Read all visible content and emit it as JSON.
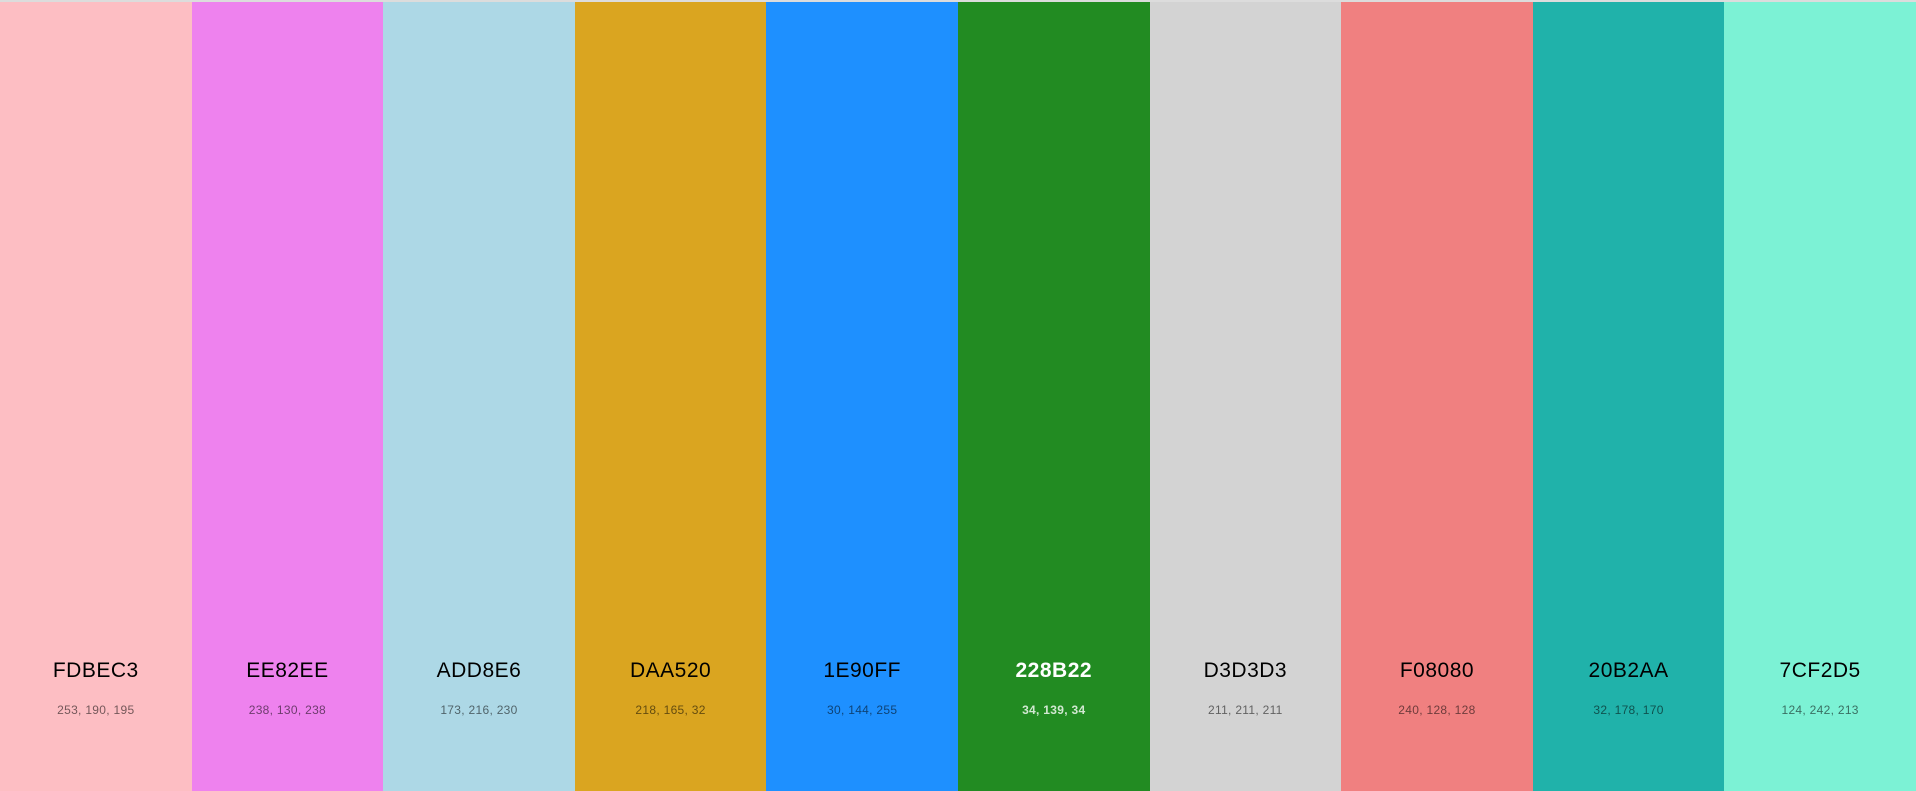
{
  "swatches": [
    {
      "hex": "FDBEC3",
      "rgb": "253, 190, 195",
      "color": "#FDBEC3"
    },
    {
      "hex": "EE82EE",
      "rgb": "238, 130, 238",
      "color": "#EE82EE"
    },
    {
      "hex": "ADD8E6",
      "rgb": "173, 216, 230",
      "color": "#ADD8E6"
    },
    {
      "hex": "DAA520",
      "rgb": "218, 165, 32",
      "color": "#DAA520"
    },
    {
      "hex": "1E90FF",
      "rgb": "30, 144, 255",
      "color": "#1E90FF"
    },
    {
      "hex": "228B22",
      "rgb": "34, 139, 34",
      "color": "#228B22"
    },
    {
      "hex": "D3D3D3",
      "rgb": "211, 211, 211",
      "color": "#D3D3D3"
    },
    {
      "hex": "F08080",
      "rgb": "240, 128, 128",
      "color": "#F08080"
    },
    {
      "hex": "20B2AA",
      "rgb": "32, 178, 170",
      "color": "#20B2AA"
    },
    {
      "hex": "7CF2D5",
      "rgb": "124, 242, 213",
      "color": "#7CF2D5"
    }
  ]
}
